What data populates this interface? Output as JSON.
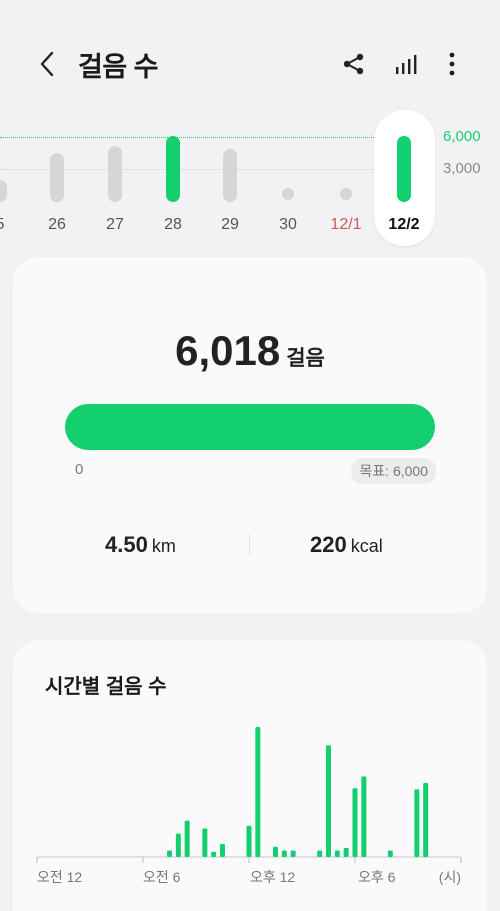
{
  "header": {
    "title": "걸음 수",
    "back_icon": "chevron-left-icon",
    "actions": [
      "share-icon",
      "bar-chart-icon",
      "more-vert-icon"
    ]
  },
  "daily_strip": {
    "y_labels": [
      "6,000",
      "3,000"
    ],
    "goal_color": "#13cf6d",
    "days": [
      {
        "label": "5",
        "level": 0.33,
        "goal_met": false
      },
      {
        "label": "26",
        "level": 0.75,
        "goal_met": false
      },
      {
        "label": "27",
        "level": 0.85,
        "goal_met": false
      },
      {
        "label": "28",
        "level": 1.0,
        "goal_met": true
      },
      {
        "label": "29",
        "level": 0.8,
        "goal_met": false
      },
      {
        "label": "30",
        "level": 0.0,
        "goal_met": false
      },
      {
        "label": "12/1",
        "level": 0.0,
        "goal_met": false,
        "holiday": true
      },
      {
        "label": "12/2",
        "level": 1.0,
        "goal_met": true,
        "selected": true
      }
    ]
  },
  "summary": {
    "steps": "6,018",
    "steps_unit": "걸음",
    "progress": 1.0,
    "progress_start": "0",
    "goal_label": "목표: 6,000",
    "distance": "4.50",
    "distance_unit": "km",
    "calories": "220",
    "calories_unit": "kcal"
  },
  "hourly": {
    "title": "시간별 걸음 수",
    "axis_labels": [
      "오전 12",
      "오전 6",
      "오후 12",
      "오후 6",
      "(시)"
    ]
  },
  "chart_data": {
    "type": "bar",
    "title": "시간별 걸음 수",
    "xlabel": "(시)",
    "ylabel": "",
    "x_ticks": [
      "오전 12",
      "오전 6",
      "오후 12",
      "오후 6"
    ],
    "ylim": [
      0,
      1
    ],
    "x_range": [
      0,
      24
    ],
    "bar_color": "#13cf6d",
    "bars": [
      {
        "x": 7.5,
        "value": 0.05
      },
      {
        "x": 8.0,
        "value": 0.18
      },
      {
        "x": 8.5,
        "value": 0.28
      },
      {
        "x": 9.5,
        "value": 0.22
      },
      {
        "x": 10.0,
        "value": 0.04
      },
      {
        "x": 10.5,
        "value": 0.1
      },
      {
        "x": 12.0,
        "value": 0.24
      },
      {
        "x": 12.5,
        "value": 1.0
      },
      {
        "x": 13.5,
        "value": 0.08
      },
      {
        "x": 14.0,
        "value": 0.05
      },
      {
        "x": 14.5,
        "value": 0.05
      },
      {
        "x": 16.0,
        "value": 0.05
      },
      {
        "x": 16.5,
        "value": 0.86
      },
      {
        "x": 17.0,
        "value": 0.05
      },
      {
        "x": 17.5,
        "value": 0.07
      },
      {
        "x": 18.0,
        "value": 0.53
      },
      {
        "x": 18.5,
        "value": 0.62
      },
      {
        "x": 20.0,
        "value": 0.05
      },
      {
        "x": 21.5,
        "value": 0.52
      },
      {
        "x": 22.0,
        "value": 0.57
      }
    ]
  }
}
